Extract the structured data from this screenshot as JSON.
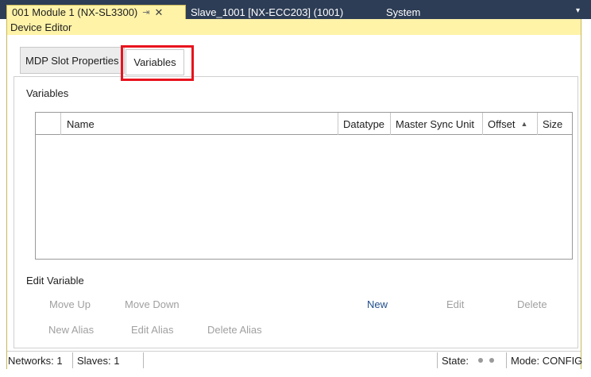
{
  "document_tabs": {
    "active": {
      "label": "001 Module 1 (NX-SL3300)",
      "pin": "⇥",
      "close": "✕"
    },
    "others": [
      "Slave_1001 [NX-ECC203] (1001)",
      "System"
    ],
    "overflow": "▾"
  },
  "editor": {
    "title": "Device Editor",
    "tabs": [
      "MDP Slot Properties",
      "Variables"
    ],
    "selected_tab": "Variables"
  },
  "variables": {
    "section_label": "Variables",
    "columns": [
      "Name",
      "Datatype",
      "Master Sync Unit",
      "Offset",
      "Size"
    ],
    "offset_sort_indicator": "▲",
    "rows": []
  },
  "edit_variable": {
    "section_label": "Edit Variable",
    "buttons": {
      "move_up": "Move Up",
      "move_down": "Move Down",
      "new": "New",
      "edit": "Edit",
      "delete": "Delete",
      "new_alias": "New Alias",
      "edit_alias": "Edit Alias",
      "delete_alias": "Delete Alias"
    }
  },
  "status_bar": {
    "networks": "Networks: 1",
    "slaves": "Slaves: 1",
    "state_label": "State:",
    "mode": "Mode: CONFIG"
  },
  "colors": {
    "tab_strip": "#2d3d56",
    "active_tab": "#fff3a8",
    "highlight_box": "#e8141e",
    "enabled_button": "#1f4e8c",
    "disabled_button": "#a0a0a0"
  }
}
